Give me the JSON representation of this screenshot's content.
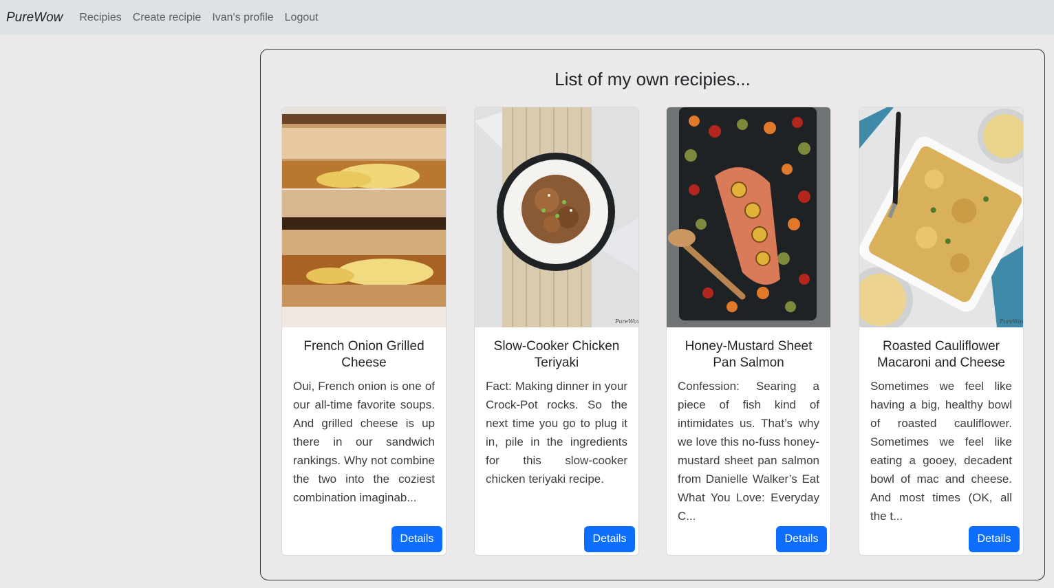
{
  "navbar": {
    "brand": "PureWow",
    "links": [
      "Recipies",
      "Create recipie",
      "Ivan's profile",
      "Logout"
    ]
  },
  "main": {
    "title": "List of my own recipies...",
    "cards": [
      {
        "title": "French Onion Grilled Cheese",
        "description": "Oui, French onion is one of our all-time favorite soups. And grilled cheese is up there in our sandwich rankings. Why not combine the two into the coziest combination imaginab...",
        "button_label": "Details",
        "image": "grilled-cheese-photo"
      },
      {
        "title": "Slow-Cooker Chicken Teriyaki",
        "description": "Fact: Making dinner in your Crock-Pot rocks. So the next time you go to plug it in, pile in the ingredients for this slow-cooker chicken teriyaki recipe.",
        "button_label": "Details",
        "image": "chicken-teriyaki-photo",
        "watermark": "PureWow"
      },
      {
        "title": "Honey-Mustard Sheet Pan Salmon",
        "description": "Confession: Searing a piece of fish kind of intimidates us. That’s why we love this no-fuss honey-mustard sheet pan salmon from Danielle Walker’s Eat What You Love: Everyday C...",
        "button_label": "Details",
        "image": "salmon-sheet-pan-photo"
      },
      {
        "title": "Roasted Cauliflower Macaroni and Cheese",
        "description": "Sometimes we feel like having a big, healthy bowl of roasted cauliflower. Sometimes we feel like eating a gooey, decadent bowl of mac and cheese. And most times (OK, all the t...",
        "button_label": "Details",
        "image": "cauliflower-mac-photo",
        "watermark": "PureWow"
      }
    ]
  },
  "colors": {
    "navbar_bg": "#dfe2e4",
    "page_bg": "#ebe9ea",
    "primary_button": "#0d6efd"
  }
}
